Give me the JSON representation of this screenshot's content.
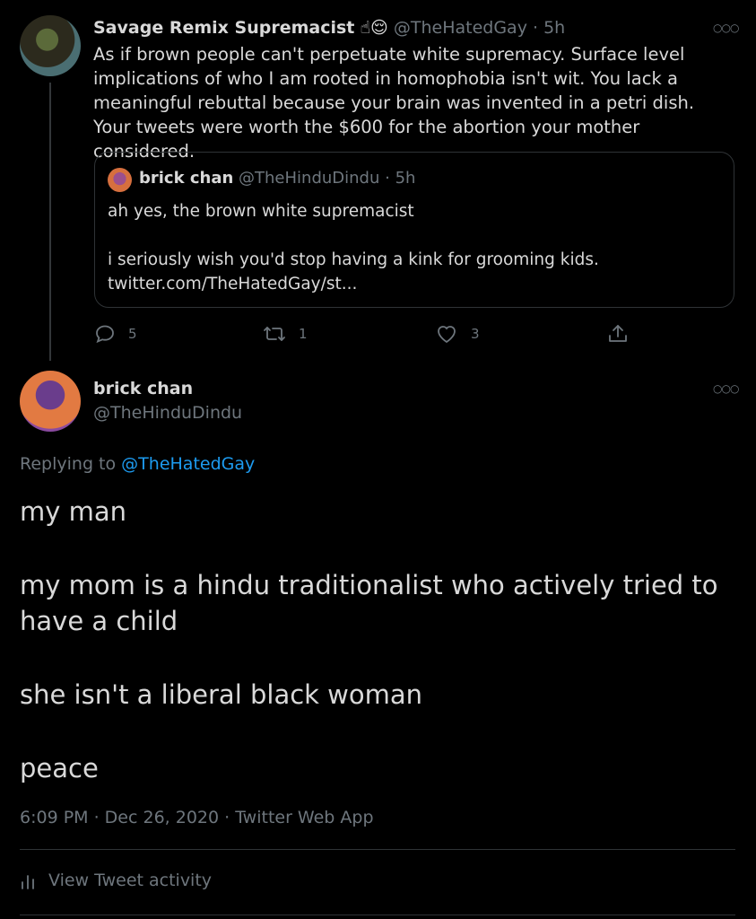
{
  "parent": {
    "name": "Savage Remix Supremacist",
    "emoji": "☝😌",
    "handle": "@TheHatedGay",
    "time": "5h",
    "text": "As if brown people can't perpetuate white supremacy. Surface level implications of who I am rooted in homophobia isn't wit. You lack a meaningful rebuttal because your brain was invented in a petri dish. Your tweets were worth the $600 for the abortion your mother considered."
  },
  "quote": {
    "name": "brick chan",
    "handle": "@TheHinduDindu",
    "time": "5h",
    "lines": [
      "ah yes, the brown white supremacist",
      "",
      "i seriously wish you'd stop having a kink for grooming kids.",
      "twitter.com/TheHatedGay/st..."
    ]
  },
  "actions": {
    "replies": "5",
    "retweets": "1",
    "likes": "3"
  },
  "main": {
    "name": "brick chan",
    "handle": "@TheHinduDindu",
    "replying_prefix": "Replying to",
    "replying_to": "@TheHatedGay",
    "paragraphs": [
      "my man",
      "my mom is a hindu traditionalist who actively tried to have a child",
      "she isn't a liberal black woman",
      "peace"
    ],
    "timestamp": "6:09 PM · Dec 26, 2020 · Twitter Web App",
    "activity_label": "View Tweet activity"
  },
  "colors": {
    "background": "#000000",
    "text": "#d9d9d9",
    "muted": "#6e767d",
    "link": "#1d9bf0",
    "border": "#2f3336"
  }
}
